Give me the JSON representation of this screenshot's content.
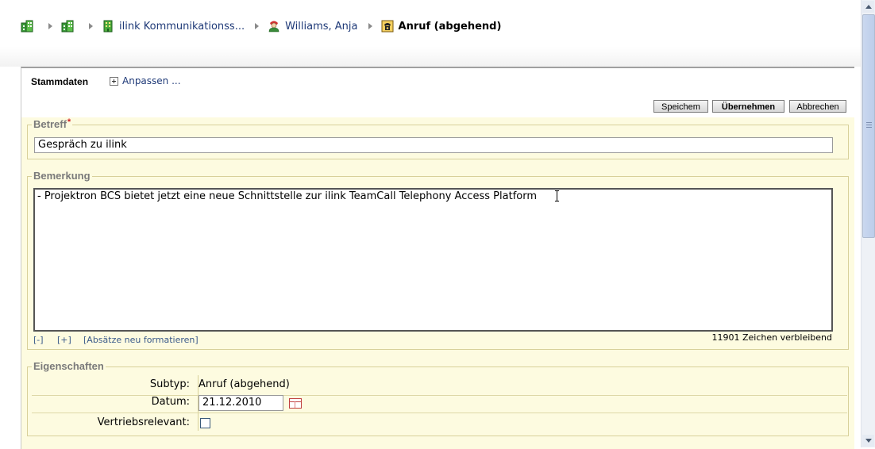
{
  "breadcrumb": [
    {
      "label": "",
      "icon": "building-icon"
    },
    {
      "label": "",
      "icon": "building-icon"
    },
    {
      "label": "ilink Kommunikationss...",
      "icon": "building-icon"
    },
    {
      "label": "Williams, Anja",
      "icon": "person-icon"
    },
    {
      "label": "Anruf (abgehend)",
      "icon": "phone-icon"
    }
  ],
  "tabs": {
    "stammdaten": "Stammdaten",
    "anpassen": "Anpassen ..."
  },
  "toolbar": {
    "save": "Speichem",
    "apply": "Übernehmen",
    "cancel": "Abbrechen"
  },
  "betreff": {
    "legend": "Betreff",
    "required_mark": "*",
    "value": "Gespräch zu ilink"
  },
  "bemerkung": {
    "legend": "Bemerkung",
    "text": "- Projektron BCS bietet jetzt eine neue Schnittstelle zur ilink TeamCall Telephony Access Platform",
    "collapse": "[-]",
    "expand": "[+]",
    "reformat": "[Absätze neu formatieren]",
    "remaining": "11901 Zeichen verbleibend"
  },
  "eigenschaften": {
    "legend": "Eigenschaften",
    "subtyp_label": "Subtyp:",
    "subtyp_value": "Anruf (abgehend)",
    "datum_label": "Datum:",
    "datum_value": "21.12.2010",
    "vertrieb_label": "Vertriebsrelevant:",
    "vertrieb_checked": false
  },
  "colors": {
    "panel_bg": "#fdfbe0",
    "link": "#1f3a78",
    "required": "#d02020"
  }
}
